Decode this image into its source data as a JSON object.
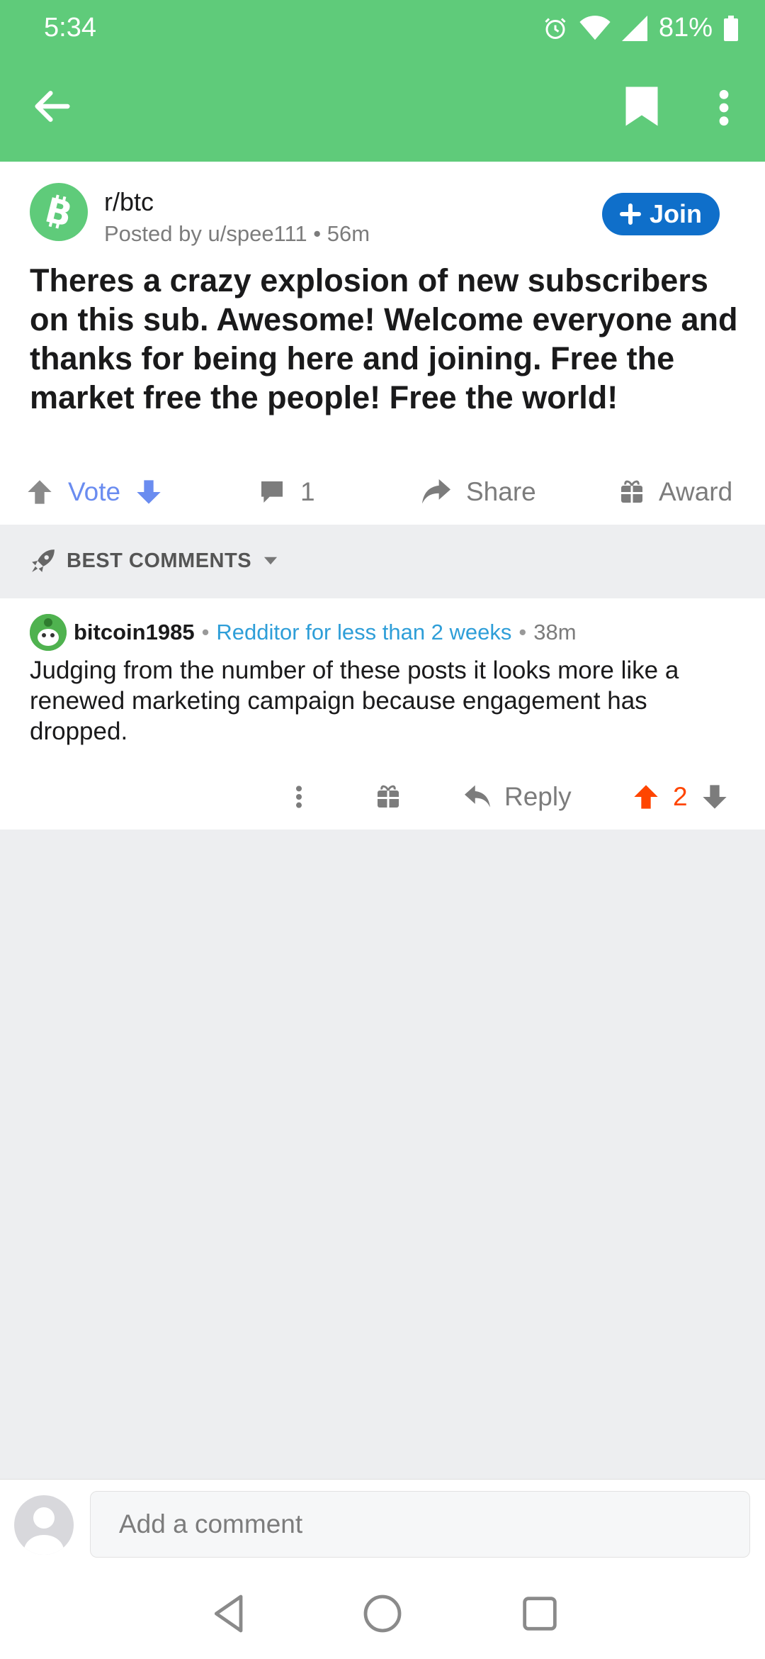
{
  "status": {
    "time": "5:34",
    "battery": "81%"
  },
  "post": {
    "subreddit": "r/btc",
    "meta": "Posted by u/spee111 • 56m",
    "join_label": "Join",
    "title": "Theres a crazy explosion of new subscribers on this sub. Awesome! Welcome everyone and thanks for being here and joining. Free the market free the people! Free the world!",
    "vote_label": "Vote",
    "comment_count": "1",
    "share_label": "Share",
    "award_label": "Award"
  },
  "sort": {
    "label": "BEST COMMENTS"
  },
  "comment": {
    "user": "bitcoin1985",
    "sep1": "•",
    "flair": "Redditor for less than 2 weeks",
    "sep2": "•",
    "time": "38m",
    "body": "Judging from the number of these posts it looks more like a renewed marketing campaign because engagement has dropped.",
    "reply_label": "Reply",
    "score": "2"
  },
  "composer": {
    "placeholder": "Add a comment"
  },
  "colors": {
    "header_green": "#5fcb7a",
    "join_blue": "#0f6fca",
    "upvote_orange": "#ff4500",
    "flair_blue": "#2e9ed8",
    "vote_blue": "#6a8cf0"
  }
}
